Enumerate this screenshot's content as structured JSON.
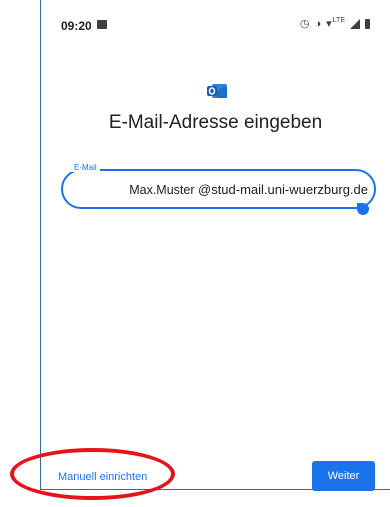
{
  "status_bar": {
    "time": "09:20",
    "icons": [
      "image-icon",
      "alarm-icon",
      "vibrate-icon",
      "wifi-icon",
      "lte-icon",
      "signal-icon",
      "battery-icon"
    ],
    "lte_label": "LTE"
  },
  "screen": {
    "title": "E-Mail-Adresse eingeben",
    "email_field": {
      "label": "E-Mail",
      "value_user": "Max.Muster",
      "value_domain": "@stud-mail.uni-wuerzburg.de"
    },
    "manual_setup_label": "Manuell einrichten",
    "next_button_label": "Weiter"
  },
  "colors": {
    "accent": "#1a73e8",
    "annotation": "#e3141c",
    "outlook_blue": "#0f5fb0"
  }
}
